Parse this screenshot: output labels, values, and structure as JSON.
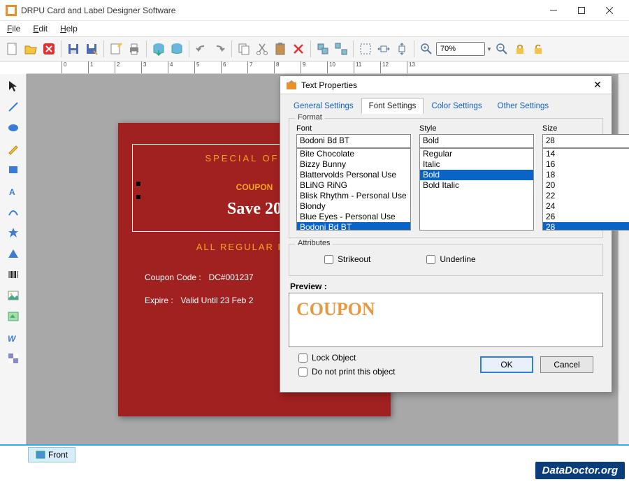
{
  "window": {
    "title": "DRPU Card and Label Designer Software"
  },
  "menu": {
    "file": "File",
    "edit": "Edit",
    "help": "Help"
  },
  "toolbar": {
    "zoom": "70%",
    "icons": [
      "new",
      "open",
      "delete",
      "save",
      "saveas",
      "edit",
      "print",
      "db1",
      "db2",
      "undo",
      "redo",
      "copy",
      "cut",
      "paste",
      "delete2",
      "group",
      "ungroup",
      "align",
      "htrans",
      "vtrans",
      "zoomin",
      "zoomout",
      "lock",
      "unlock"
    ]
  },
  "leftbar": [
    "pointer",
    "line",
    "ellipse",
    "pencil",
    "rect",
    "text",
    "phone",
    "star",
    "triangle",
    "barcode",
    "image",
    "picture",
    "wordart",
    "checker"
  ],
  "canvas": {
    "special": "SPECIAL OFFER",
    "coupon": "COUPON",
    "save": "Save 20",
    "allreg": "ALL REGULAR PRICE",
    "code_label": "Coupon Code :",
    "code_value": "DC#001237",
    "expire_label": "Expire :",
    "expire_value": "Valid Until 23 Feb 2"
  },
  "bottomtab": "Front",
  "watermark": "DataDoctor.org",
  "dialog": {
    "title": "Text Properties",
    "tabs": {
      "general": "General Settings",
      "font": "Font Settings",
      "color": "Color Settings",
      "other": "Other Settings"
    },
    "format": {
      "legend": "Format",
      "font_label": "Font",
      "font_value": "Bodoni Bd BT",
      "font_list": [
        "Bite Chocolate",
        "Bizzy Bunny",
        "Blattervolds Personal Use",
        "BLiNG RiNG",
        "Blisk Rhythm - Personal Use",
        "Blondy",
        "Blue Eyes - Personal Use",
        "Bodoni Bd BT"
      ],
      "font_selected": "Bodoni Bd BT",
      "style_label": "Style",
      "style_value": "Bold",
      "style_list": [
        "Regular",
        "Italic",
        "Bold",
        "Bold Italic"
      ],
      "style_selected": "Bold",
      "size_label": "Size",
      "size_value": "28",
      "size_list": [
        "14",
        "16",
        "18",
        "20",
        "22",
        "24",
        "26",
        "28"
      ],
      "size_selected": "28"
    },
    "attributes": {
      "legend": "Attributes",
      "strikeout": "Strikeout",
      "underline": "Underline"
    },
    "preview_label": "Preview :",
    "preview_text": "COUPON",
    "lock": "Lock Object",
    "noprint": "Do not print this object",
    "ok": "OK",
    "cancel": "Cancel"
  }
}
